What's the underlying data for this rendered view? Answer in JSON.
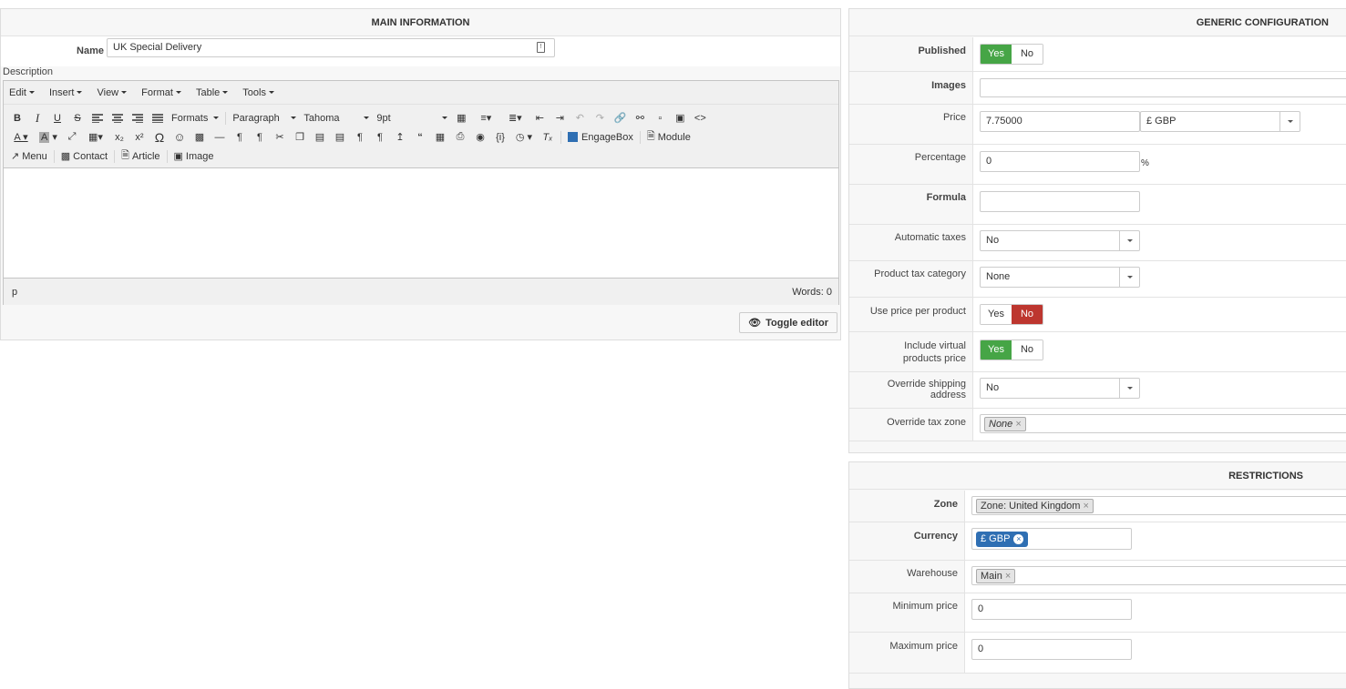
{
  "main": {
    "title": "MAIN INFORMATION",
    "name_label": "Name",
    "name_value": "UK Special Delivery",
    "description_label": "Description",
    "menus": [
      "Edit",
      "Insert",
      "View",
      "Format",
      "Table",
      "Tools"
    ],
    "formats_label": "Formats",
    "block_format": "Paragraph",
    "font_family": "Tahoma",
    "font_size": "9pt",
    "engagebox_label": "EngageBox",
    "module_label": "Module",
    "menu_label": "Menu",
    "contact_label": "Contact",
    "article_label": "Article",
    "image_label": "Image",
    "status_path": "p",
    "word_count": "Words: 0",
    "toggle_editor_label": "Toggle editor"
  },
  "generic": {
    "title": "GENERIC CONFIGURATION",
    "published_label": "Published",
    "yes": "Yes",
    "no": "No",
    "images_label": "Images",
    "price_label": "Price",
    "price_value": "7.75000",
    "currency_value": "£ GBP",
    "percentage_label": "Percentage",
    "percentage_value": "0",
    "percent_sign": "%",
    "formula_label": "Formula",
    "auto_taxes_label": "Automatic taxes",
    "auto_taxes_value": "No",
    "tax_category_label": "Product tax category",
    "tax_category_value": "None",
    "price_per_product_label": "Use price per product",
    "include_virtual_label_1": "Include virtual",
    "include_virtual_label_2": "products price",
    "override_shipping_label": "Override shipping address",
    "override_shipping_value": "No",
    "override_tax_zone_label": "Override tax zone",
    "override_tax_zone_chip": "None"
  },
  "restrictions": {
    "title": "RESTRICTIONS",
    "zone_label": "Zone",
    "zone_chip": "Zone: United Kingdom",
    "currency_label": "Currency",
    "currency_chip": "£ GBP",
    "warehouse_label": "Warehouse",
    "warehouse_chip": "Main",
    "min_price_label": "Minimum price",
    "min_price_value": "0",
    "max_price_label": "Maximum price",
    "max_price_value": "0"
  },
  "state": {
    "published": "yes",
    "use_price_per_product": "no",
    "include_virtual": "yes"
  }
}
